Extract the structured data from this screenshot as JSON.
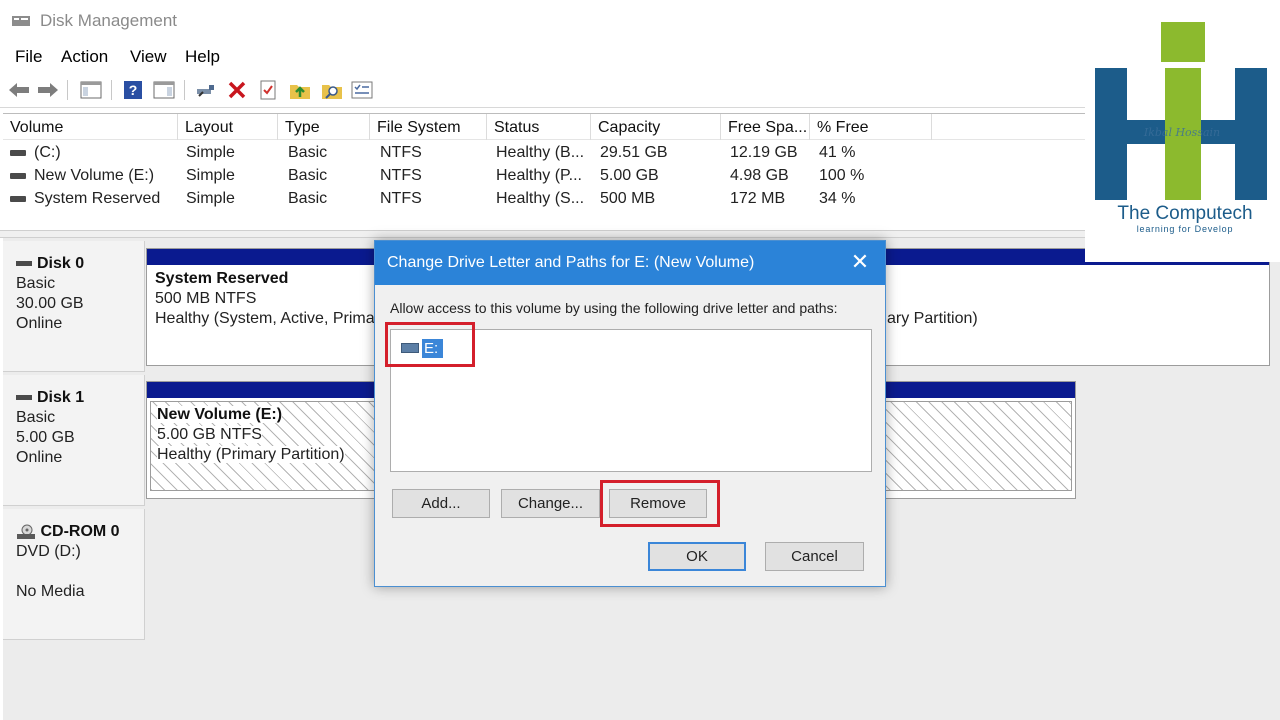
{
  "window": {
    "title": "Disk Management"
  },
  "menu": [
    "File",
    "Action",
    "View",
    "Help"
  ],
  "toolbar_icons": [
    "back-arrow-icon",
    "forward-arrow-icon",
    "console-tree-icon",
    "help-icon",
    "action-pane-icon",
    "connect-icon",
    "delete-icon",
    "properties-icon",
    "up-folder-icon",
    "search-icon",
    "list-view-icon"
  ],
  "volume_list": {
    "columns": [
      "Volume",
      "Layout",
      "Type",
      "File System",
      "Status",
      "Capacity",
      "Free Spa...",
      "% Free"
    ],
    "rows": [
      [
        "(C:)",
        "Simple",
        "Basic",
        "NTFS",
        "Healthy (B...",
        "29.51 GB",
        "12.19 GB",
        "41 %"
      ],
      [
        "New Volume (E:)",
        "Simple",
        "Basic",
        "NTFS",
        "Healthy (P...",
        "5.00 GB",
        "4.98 GB",
        "100 %"
      ],
      [
        "System Reserved",
        "Simple",
        "Basic",
        "NTFS",
        "Healthy (S...",
        "500 MB",
        "172 MB",
        "34 %"
      ]
    ]
  },
  "disks": [
    {
      "name": "Disk 0",
      "type": "Basic",
      "size": "30.00 GB",
      "state": "Online",
      "partitions": [
        {
          "name": "System Reserved",
          "detail": "500 MB NTFS",
          "status": "Healthy (System, Active, Prima"
        },
        {
          "name": "",
          "detail": "",
          "status": "ary Partition)"
        }
      ]
    },
    {
      "name": "Disk 1",
      "type": "Basic",
      "size": "5.00 GB",
      "state": "Online",
      "partitions": [
        {
          "name": "New Volume  (E:)",
          "detail": "5.00 GB NTFS",
          "status": "Healthy (Primary Partition)"
        }
      ]
    },
    {
      "name": "CD-ROM 0",
      "type": "DVD (D:)",
      "size": "",
      "state": "No Media",
      "partitions": []
    }
  ],
  "dialog": {
    "title": "Change Drive Letter and Paths for E: (New Volume)",
    "close_glyph": "✕",
    "description": "Allow access to this volume by using the following drive letter and paths:",
    "items": [
      "E:"
    ],
    "buttons": {
      "add": "Add...",
      "change": "Change...",
      "remove": "Remove",
      "ok": "OK",
      "cancel": "Cancel"
    }
  },
  "logo": {
    "title": "The Computech",
    "subtitle": "learning for Develop",
    "signature": "Ikbal Hossain"
  },
  "colors": {
    "dialog_title": "#2b83d8",
    "highlight": "#d41f2b",
    "partition_bar": "#0a1a8f",
    "logo_blue": "#1c5c8a",
    "logo_green": "#8cba2e"
  }
}
